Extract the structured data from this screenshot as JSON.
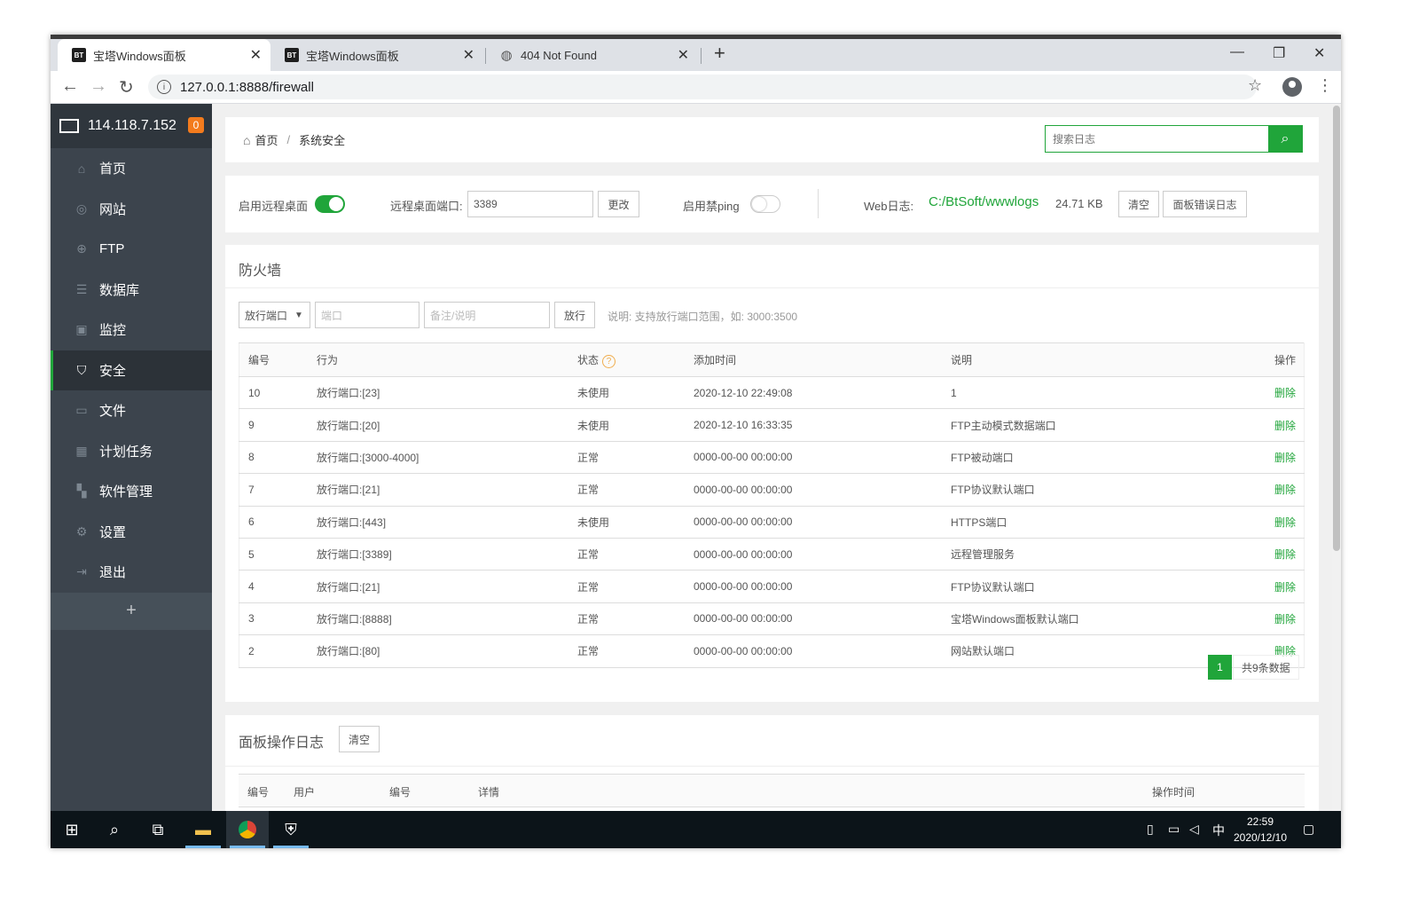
{
  "browser": {
    "tabs": [
      {
        "title": "宝塔Windows面板",
        "favicon": "BT",
        "active": true
      },
      {
        "title": "宝塔Windows面板",
        "favicon": "BT",
        "active": false
      },
      {
        "title": "404 Not Found",
        "favicon": "globe",
        "active": false
      }
    ],
    "url": "127.0.0.1:8888/firewall"
  },
  "sidebar": {
    "ip": "114.118.7.152",
    "badge": "0",
    "items": [
      {
        "label": "首页",
        "icon": "home-icon"
      },
      {
        "label": "网站",
        "icon": "globe-icon"
      },
      {
        "label": "FTP",
        "icon": "ftp-icon"
      },
      {
        "label": "数据库",
        "icon": "database-icon"
      },
      {
        "label": "监控",
        "icon": "monitor-icon"
      },
      {
        "label": "安全",
        "icon": "shield-icon",
        "active": true
      },
      {
        "label": "文件",
        "icon": "folder-icon"
      },
      {
        "label": "计划任务",
        "icon": "calendar-icon"
      },
      {
        "label": "软件管理",
        "icon": "apps-icon"
      },
      {
        "label": "设置",
        "icon": "gear-icon"
      },
      {
        "label": "退出",
        "icon": "logout-icon"
      }
    ],
    "add_label": "+"
  },
  "breadcrumb": {
    "home": "首页",
    "sep": "/",
    "current": "系统安全"
  },
  "search": {
    "placeholder": "搜索日志"
  },
  "settings": {
    "remote_desktop_label": "启用远程桌面",
    "remote_desktop_on": true,
    "port_label": "远程桌面端口:",
    "port_value": "3389",
    "change_label": "更改",
    "ping_label": "启用禁ping",
    "ping_on": false,
    "weblog_label": "Web日志:",
    "weblog_path": "C:/BtSoft/wwwlogs",
    "weblog_size": "24.71 KB",
    "clear_label": "清空",
    "error_log_label": "面板错误日志"
  },
  "firewall": {
    "title": "防火墙",
    "type_select": "放行端口",
    "port_placeholder": "端口",
    "remark_placeholder": "备注/说明",
    "allow_label": "放行",
    "hint": "说明: 支持放行端口范围，如: 3000:3500",
    "columns": [
      "编号",
      "行为",
      "状态",
      "添加时间",
      "说明",
      "操作"
    ],
    "rows": [
      {
        "id": "10",
        "action": "放行端口:[23]",
        "status": "未使用",
        "time": "2020-12-10 22:49:08",
        "note": "1",
        "op": "删除"
      },
      {
        "id": "9",
        "action": "放行端口:[20]",
        "status": "未使用",
        "time": "2020-12-10 16:33:35",
        "note": "FTP主动模式数据端口",
        "op": "删除"
      },
      {
        "id": "8",
        "action": "放行端口:[3000-4000]",
        "status": "正常",
        "time": "0000-00-00 00:00:00",
        "note": "FTP被动端口",
        "op": "删除"
      },
      {
        "id": "7",
        "action": "放行端口:[21]",
        "status": "正常",
        "time": "0000-00-00 00:00:00",
        "note": "FTP协议默认端口",
        "op": "删除"
      },
      {
        "id": "6",
        "action": "放行端口:[443]",
        "status": "未使用",
        "time": "0000-00-00 00:00:00",
        "note": "HTTPS端口",
        "op": "删除"
      },
      {
        "id": "5",
        "action": "放行端口:[3389]",
        "status": "正常",
        "time": "0000-00-00 00:00:00",
        "note": "远程管理服务",
        "op": "删除"
      },
      {
        "id": "4",
        "action": "放行端口:[21]",
        "status": "正常",
        "time": "0000-00-00 00:00:00",
        "note": "FTP协议默认端口",
        "op": "删除"
      },
      {
        "id": "3",
        "action": "放行端口:[8888]",
        "status": "正常",
        "time": "0000-00-00 00:00:00",
        "note": "宝塔Windows面板默认端口",
        "op": "删除"
      },
      {
        "id": "2",
        "action": "放行端口:[80]",
        "status": "正常",
        "time": "0000-00-00 00:00:00",
        "note": "网站默认端口",
        "op": "删除"
      }
    ],
    "page_current": "1",
    "page_total": "共9条数据"
  },
  "oplog": {
    "title": "面板操作日志",
    "clear_label": "清空",
    "columns": [
      "编号",
      "用户",
      "编号",
      "详情",
      "操作时间"
    ]
  },
  "taskbar": {
    "time": "22:59",
    "date": "2020/12/10",
    "ime": "中"
  },
  "colors": {
    "accent": "#20a53a",
    "sidebar": "#3c444d",
    "badge": "#f37b1d"
  }
}
